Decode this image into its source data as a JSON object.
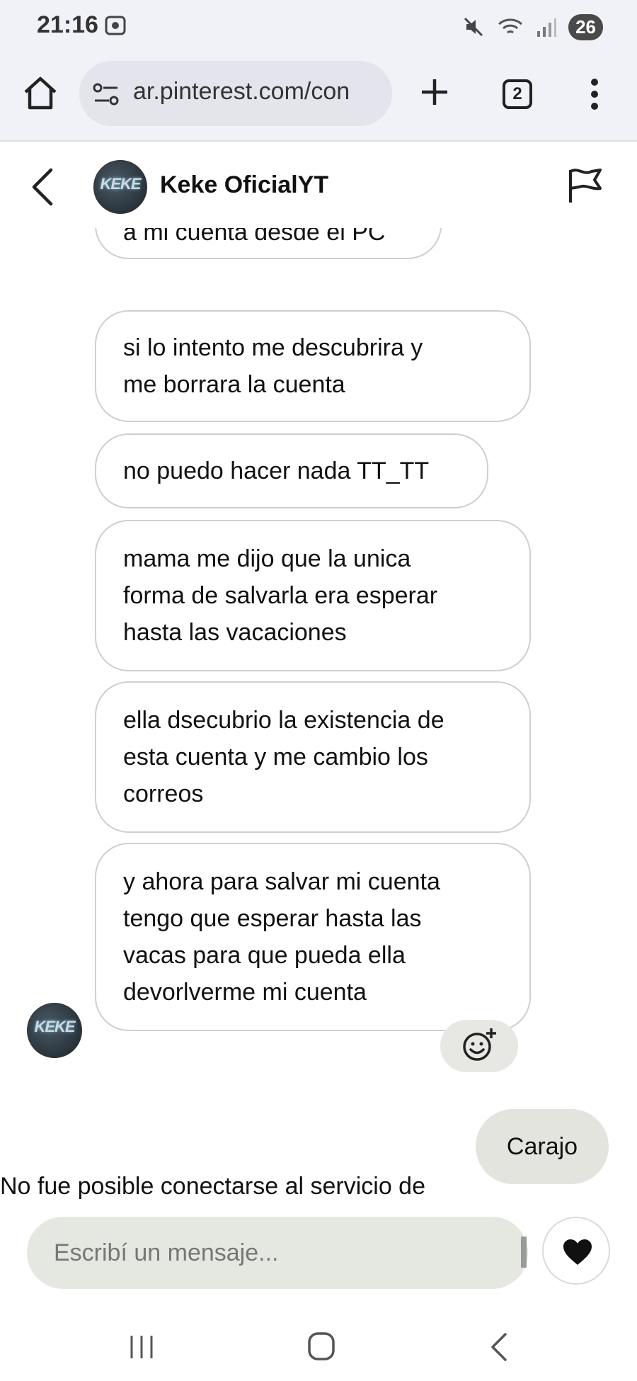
{
  "status_bar": {
    "time": "21:16",
    "battery": "26",
    "icons": [
      "screen-record-icon",
      "mute-icon",
      "wifi-icon",
      "signal-icon"
    ]
  },
  "browser": {
    "url": "ar.pinterest.com/con",
    "tab_count": "2",
    "icons": [
      "home-icon",
      "site-settings-icon",
      "plus-icon",
      "tabs-icon",
      "more-vert-icon"
    ]
  },
  "chat": {
    "contact_name": "Keke OficialYT",
    "avatar_text": "KEKE",
    "messages": [
      {
        "lines": [
          "a mi cuenta desde el PC"
        ]
      },
      {
        "lines": [
          "si lo intento me descubrira y",
          "me borrara la cuenta"
        ]
      },
      {
        "lines": [
          "no puedo hacer nada TT_TT"
        ]
      },
      {
        "lines": [
          "mama me dijo que la unica",
          "forma de salvarla era esperar",
          "hasta las vacaciones"
        ]
      },
      {
        "lines": [
          "ella dsecubrio la existencia de",
          "esta cuenta y me cambio los",
          "correos"
        ]
      },
      {
        "lines": [
          "y ahora para salvar mi cuenta",
          "tengo que esperar hasta las",
          "vacas para que pueda ella",
          "devorlverme mi cuenta"
        ]
      }
    ],
    "sent_message": "Carajo",
    "error_text": "No fue posible conectarse al servicio de"
  },
  "composer": {
    "placeholder": "Escribí un mensaje..."
  },
  "colors": {
    "browser_bg": "#f1f2f8",
    "bubble_border": "#cfcfcf",
    "sent_bubble_bg": "#e3e4de",
    "input_bg": "#e5e8e1"
  }
}
